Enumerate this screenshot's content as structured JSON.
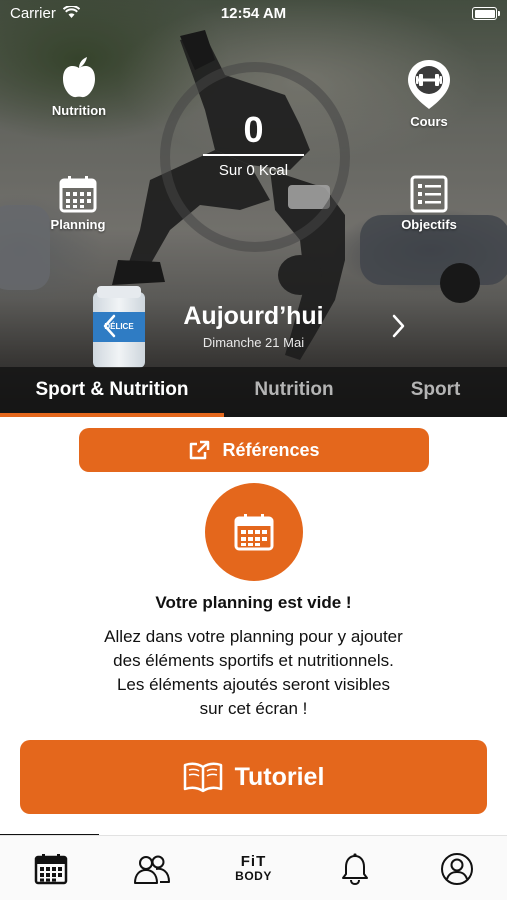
{
  "status_bar": {
    "carrier": "Carrier",
    "time": "12:54 AM"
  },
  "hero": {
    "actions": [
      {
        "label": "Nutrition",
        "icon": "apple-icon"
      },
      {
        "label": "Cours",
        "icon": "dumbbell-pin-icon"
      },
      {
        "label": "Planning",
        "icon": "calendar-icon"
      },
      {
        "label": "Objectifs",
        "icon": "checklist-icon"
      }
    ],
    "kcal": {
      "value": "0",
      "subtitle": "Sur 0 Kcal"
    },
    "date_nav": {
      "title": "Aujourd’hui",
      "date": "Dimanche 21 Mai"
    }
  },
  "tabs": [
    {
      "label": "Sport & Nutrition",
      "active": true
    },
    {
      "label": "Nutrition",
      "active": false
    },
    {
      "label": "Sport",
      "active": false
    }
  ],
  "content": {
    "references_button": "Références",
    "empty_title": "Votre planning est vide !",
    "empty_text": "Allez dans votre planning pour y ajouter\ndes éléments sportifs et nutritionnels.\nLes éléments ajoutés seront visibles\nsur cet écran !",
    "tutorial_button": "Tutoriel"
  },
  "bottom_nav": {
    "items": [
      "calendar-icon",
      "community-icon",
      "fitbody-logo",
      "bell-icon",
      "profile-icon"
    ],
    "logo_line1": "FiT",
    "logo_line2": "BODY"
  },
  "colors": {
    "accent": "#e4671c",
    "tab_bar": "#141414",
    "inactive_tab": "#b4b4b4"
  }
}
